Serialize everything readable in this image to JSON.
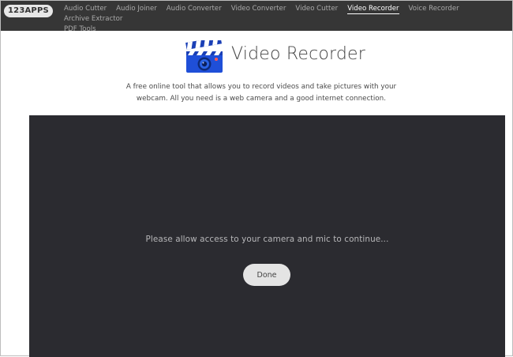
{
  "brand": {
    "logo_text": "123APPS"
  },
  "nav": {
    "items": [
      {
        "label": "Audio Cutter"
      },
      {
        "label": "Audio Joiner"
      },
      {
        "label": "Audio Converter"
      },
      {
        "label": "Video Converter"
      },
      {
        "label": "Video Cutter"
      },
      {
        "label": "Video Recorder",
        "active": true
      },
      {
        "label": "Voice Recorder"
      },
      {
        "label": "Archive Extractor"
      },
      {
        "label": "PDF Tools"
      }
    ]
  },
  "hero": {
    "title": "Video Recorder",
    "description": "A free online tool that allows you to record videos and take pictures with your webcam. All you need is a web camera and a good internet connection.",
    "icon": "video-clapperboard-icon"
  },
  "stage": {
    "prompt": "Please allow access to your camera and mic to continue...",
    "done_label": "Done"
  },
  "colors": {
    "topbar": "#363636",
    "stage": "#2b2b30",
    "icon_blue": "#1f4fd8",
    "button_bg": "#e4e4e4"
  }
}
